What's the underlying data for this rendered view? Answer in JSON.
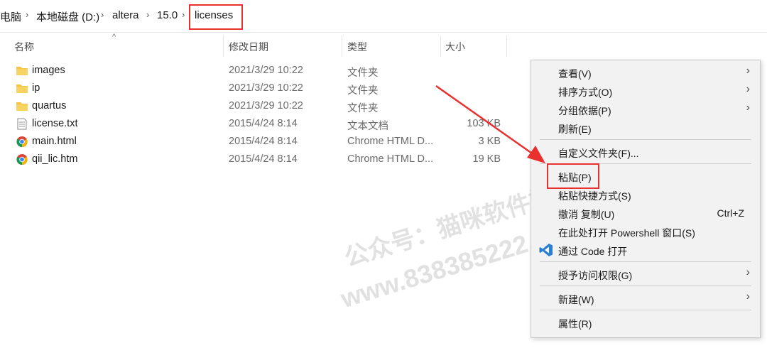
{
  "breadcrumb": {
    "items": [
      "电脑",
      "本地磁盘 (D:)",
      "altera",
      "15.0",
      "licenses"
    ],
    "separator": "›"
  },
  "columns": {
    "name": "名称",
    "date": "修改日期",
    "type": "类型",
    "size": "大小",
    "sort_indicator": "^"
  },
  "files": [
    {
      "name": "images",
      "date": "2021/3/29 10:22",
      "type": "文件夹",
      "size": "",
      "icon": "folder-icon"
    },
    {
      "name": "ip",
      "date": "2021/3/29 10:22",
      "type": "文件夹",
      "size": "",
      "icon": "folder-icon"
    },
    {
      "name": "quartus",
      "date": "2021/3/29 10:22",
      "type": "文件夹",
      "size": "",
      "icon": "folder-icon"
    },
    {
      "name": "license.txt",
      "date": "2015/4/24 8:14",
      "type": "文本文档",
      "size": "103 KB",
      "icon": "text-file-icon"
    },
    {
      "name": "main.html",
      "date": "2015/4/24 8:14",
      "type": "Chrome HTML D...",
      "size": "3 KB",
      "icon": "chrome-icon"
    },
    {
      "name": "qii_lic.htm",
      "date": "2015/4/24 8:14",
      "type": "Chrome HTML D...",
      "size": "19 KB",
      "icon": "chrome-icon"
    }
  ],
  "context_menu": {
    "view": "查看(V)",
    "sort_by": "排序方式(O)",
    "group_by": "分组依据(P)",
    "refresh": "刷新(E)",
    "customize_folder": "自定义文件夹(F)...",
    "paste": "粘贴(P)",
    "paste_shortcut": "粘贴快捷方式(S)",
    "undo_copy": "撤消 复制(U)",
    "undo_shortcut": "Ctrl+Z",
    "open_powershell": "在此处打开 Powershell 窗口(S)",
    "open_with_code": "通过 Code 打开",
    "give_access": "授予访问权限(G)",
    "new": "新建(W)",
    "properties": "属性(R)",
    "submenu_arrow": "›"
  },
  "watermark": {
    "line1": "公众号：猫咪软件社",
    "line2": "www.838385222.xyz"
  },
  "colors": {
    "highlight_red": "#e8302f",
    "folder_yellow": "#f4c542",
    "vscode_blue": "#2a7ed3"
  }
}
